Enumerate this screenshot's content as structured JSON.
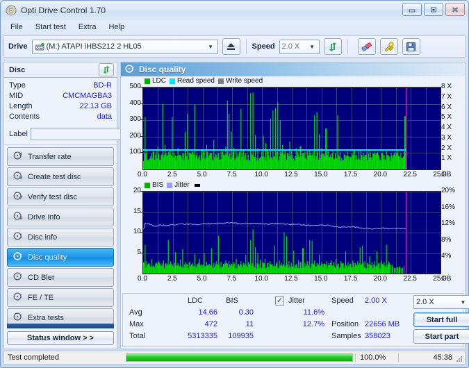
{
  "window": {
    "title": "Opti Drive Control 1.70",
    "app_icon": "disc-icon",
    "minimize_label": "─",
    "maximize_label": "▣",
    "close_label": "✕"
  },
  "menu": {
    "items": [
      "File",
      "Start test",
      "Extra",
      "Help"
    ]
  },
  "toolbar": {
    "drive_label": "Drive",
    "drive_value": "(M:)   ATAPI iHBS212  2 HL05",
    "eject_icon": "eject-icon",
    "speed_label": "Speed",
    "speed_value": "2.0 X",
    "refresh_icon": "refresh-icon",
    "eraser_icon": "eraser-icon",
    "tools_icon": "tools-icon",
    "save_icon": "floppy-save-icon"
  },
  "disc": {
    "header": "Disc",
    "refresh_icon": "refresh-icon",
    "rows": [
      {
        "key": "Type",
        "value": "BD-R"
      },
      {
        "key": "MID",
        "value": "CMCMAGBA3"
      },
      {
        "key": "Length",
        "value": "22.13 GB"
      },
      {
        "key": "Contents",
        "value": "data"
      }
    ],
    "label_key": "Label",
    "label_value": "",
    "label_placeholder": "",
    "disc_icon": "cd-disc-icon"
  },
  "nav": {
    "items": [
      {
        "label": "Transfer rate",
        "icon": "disc-speed-icon",
        "selected": false
      },
      {
        "label": "Create test disc",
        "icon": "disc-burn-icon",
        "selected": false
      },
      {
        "label": "Verify test disc",
        "icon": "disc-check-icon",
        "selected": false
      },
      {
        "label": "Drive info",
        "icon": "disc-info-icon",
        "selected": false
      },
      {
        "label": "Disc info",
        "icon": "disc-info-icon",
        "selected": false
      },
      {
        "label": "Disc quality",
        "icon": "disc-quality-icon",
        "selected": true
      },
      {
        "label": "CD Bler",
        "icon": "disc-bler-icon",
        "selected": false
      },
      {
        "label": "FE / TE",
        "icon": "disc-fete-icon",
        "selected": false
      },
      {
        "label": "Extra tests",
        "icon": "disc-extra-icon",
        "selected": false
      }
    ],
    "status_window_button": "Status window > >"
  },
  "panel": {
    "title": "Disc quality",
    "icon": "disc-quality-icon"
  },
  "stats": {
    "col_ldc": "LDC",
    "col_bis": "BIS",
    "jitter_label": "Jitter",
    "jitter_checked": true,
    "row_avg": "Avg",
    "row_max": "Max",
    "row_total": "Total",
    "avg_ldc": "14.66",
    "avg_bis": "0.30",
    "avg_jitter": "11.6%",
    "max_ldc": "472",
    "max_bis": "11",
    "max_jitter": "12.7%",
    "total_ldc": "5313335",
    "total_bis": "109935",
    "speed_label": "Speed",
    "speed_value": "2.00 X",
    "position_label": "Position",
    "position_value": "22656 MB",
    "samples_label": "Samples",
    "samples_value": "358023",
    "speed_select": "2.0 X",
    "start_full": "Start full",
    "start_part": "Start part"
  },
  "statusbar": {
    "text": "Test completed",
    "progress_percent": 100,
    "percent_label": "100.0%",
    "elapsed": "45:38"
  },
  "colors": {
    "accent_blue": "#1e95e8",
    "value_blue": "#2222cc",
    "plot_bg": "#00007e",
    "ldc_green": "#00e000",
    "read_speed_cyan": "#00e5ff",
    "write_speed_gray": "#808080",
    "bis_green": "#00e000",
    "jitter_periwinkle": "#9a9aff",
    "marker_magenta": "#cc33cc",
    "progress_green": "#22cc22"
  },
  "chart_data": [
    {
      "type": "area",
      "title": "LDC / Read speed / Write speed",
      "xlabel": "GB",
      "ylabel": "LDC",
      "y2label": "X",
      "xlim": [
        0,
        25
      ],
      "xticks": [
        "0.0",
        "2.5",
        "5.0",
        "7.5",
        "10.0",
        "12.5",
        "15.0",
        "17.5",
        "20.0",
        "22.5",
        "25.0"
      ],
      "ylim": [
        0,
        500
      ],
      "yticks": [
        100,
        200,
        300,
        400,
        500
      ],
      "y2lim": [
        0,
        8
      ],
      "y2ticks": [
        "1 X",
        "2 X",
        "3 X",
        "4 X",
        "5 X",
        "6 X",
        "7 X",
        "8 X"
      ],
      "grid": true,
      "legend": [
        {
          "name": "LDC",
          "color": "#00b000"
        },
        {
          "name": "Read speed",
          "color": "#00e5ff"
        },
        {
          "name": "Write speed",
          "color": "#808080"
        }
      ],
      "data_end_gb": 22.1,
      "marker_gb": 22.1,
      "read_speed_constant_x": 2.0,
      "series": [
        {
          "name": "LDC",
          "color": "#00e000",
          "x": [
            0.1,
            0.25,
            0.4,
            0.6,
            0.8,
            1.0,
            1.2,
            1.4,
            1.6,
            1.8,
            2.0,
            2.2,
            2.4,
            2.55,
            2.7,
            2.9,
            3.1,
            3.3,
            3.5,
            3.7,
            3.9,
            4.1,
            4.3,
            4.5,
            4.7,
            4.9,
            5.1,
            5.3,
            5.5,
            5.7,
            5.9,
            6.1,
            6.3,
            6.5,
            6.7,
            6.9,
            7.05,
            7.2,
            7.4,
            7.6,
            7.8,
            8.0,
            8.2,
            8.4,
            8.6,
            8.8,
            9.0,
            9.2,
            9.4,
            9.6,
            9.8,
            9.95,
            10.1,
            10.25,
            10.4,
            10.55,
            10.7,
            10.9,
            11.1,
            11.3,
            11.5,
            11.7,
            11.9,
            12.1,
            12.3,
            12.45,
            12.6,
            12.8,
            13.0,
            13.2,
            13.4,
            13.6,
            13.8,
            14.0,
            14.2,
            14.4,
            14.6,
            14.8,
            15.0,
            15.2,
            15.35,
            15.5,
            15.7,
            15.9,
            16.1,
            16.3,
            16.5,
            16.7,
            16.9,
            17.1,
            17.3,
            17.5,
            17.7,
            17.9,
            18.1,
            18.3,
            18.5,
            18.7,
            18.9,
            19.1,
            19.3,
            19.5,
            19.7,
            19.9,
            20.05,
            20.2,
            20.4,
            20.6,
            20.8,
            21.0,
            21.2,
            21.4,
            21.6,
            21.8,
            22.0,
            22.1
          ],
          "y": [
            318,
            120,
            95,
            80,
            110,
            90,
            140,
            95,
            400,
            150,
            90,
            115,
            320,
            100,
            85,
            130,
            90,
            100,
            230,
            340,
            95,
            110,
            395,
            100,
            90,
            120,
            95,
            150,
            85,
            100,
            180,
            90,
            100,
            110,
            95,
            140,
            420,
            340,
            230,
            130,
            110,
            95,
            370,
            120,
            100,
            90,
            465,
            470,
            210,
            130,
            95,
            110,
            205,
            160,
            120,
            95,
            310,
            360,
            375,
            410,
            300,
            150,
            120,
            100,
            170,
            110,
            95,
            130,
            90,
            140,
            100,
            95,
            110,
            120,
            90,
            330,
            350,
            215,
            130,
            95,
            250,
            110,
            90,
            120,
            100,
            330,
            105,
            95,
            90,
            110,
            95,
            100,
            120,
            90,
            110,
            95,
            100,
            90,
            110,
            95,
            100,
            90,
            105,
            95,
            100,
            90,
            110,
            95,
            100,
            90,
            105,
            95,
            100,
            95,
            325,
            110
          ]
        }
      ]
    },
    {
      "type": "area",
      "title": "BIS / Jitter",
      "xlabel": "GB",
      "ylabel": "BIS",
      "y2label": "%",
      "xlim": [
        0,
        25
      ],
      "xticks": [
        "0.0",
        "2.5",
        "5.0",
        "7.5",
        "10.0",
        "12.5",
        "15.0",
        "17.5",
        "20.0",
        "22.5",
        "25.0"
      ],
      "ylim": [
        0,
        20
      ],
      "yticks": [
        5,
        10,
        15,
        20
      ],
      "y2lim": [
        0,
        20
      ],
      "y2ticks": [
        "4%",
        "8%",
        "12%",
        "16%",
        "20%"
      ],
      "grid": true,
      "legend": [
        {
          "name": "BIS",
          "color": "#00b000"
        },
        {
          "name": "Jitter",
          "color": "#9a9aff"
        }
      ],
      "data_end_gb": 22.1,
      "marker_gb": 22.1,
      "series": [
        {
          "name": "BIS",
          "color": "#00e000",
          "x": [
            0.1,
            0.3,
            0.5,
            0.7,
            0.9,
            1.1,
            1.3,
            1.5,
            1.7,
            1.9,
            2.1,
            2.3,
            2.5,
            2.7,
            2.9,
            3.1,
            3.3,
            3.5,
            3.7,
            3.9,
            4.1,
            4.3,
            4.5,
            4.7,
            4.9,
            5.1,
            5.3,
            5.5,
            5.7,
            5.9,
            6.1,
            6.3,
            6.5,
            6.7,
            6.9,
            7.0,
            7.2,
            7.4,
            7.6,
            7.8,
            8.0,
            8.2,
            8.4,
            8.6,
            8.8,
            9.0,
            9.2,
            9.4,
            9.6,
            9.8,
            10.0,
            10.2,
            10.4,
            10.6,
            10.8,
            11.0,
            11.2,
            11.4,
            11.6,
            11.8,
            12.0,
            12.2,
            12.4,
            12.6,
            12.8,
            13.0,
            13.2,
            13.4,
            13.6,
            13.8,
            14.0,
            14.2,
            14.4,
            14.6,
            14.8,
            15.0,
            15.2,
            15.4,
            15.6,
            15.8,
            16.0,
            16.2,
            16.4,
            16.6,
            16.8,
            17.0,
            17.2,
            17.4,
            17.6,
            17.8,
            18.0,
            18.2,
            18.4,
            18.6,
            18.8,
            19.0,
            19.2,
            19.4,
            19.6,
            19.8,
            20.0,
            20.2,
            20.4,
            20.6,
            20.8,
            21.0,
            21.2,
            21.4,
            21.6,
            21.8,
            22.0,
            22.1
          ],
          "y": [
            7.0,
            3.0,
            2.5,
            3.5,
            2.0,
            2.8,
            3.0,
            2.4,
            3.2,
            2.6,
            8.2,
            3.0,
            2.2,
            5.2,
            2.6,
            3.4,
            6.0,
            2.8,
            2.2,
            3.0,
            2.6,
            4.8,
            2.4,
            3.6,
            2.2,
            5.0,
            2.8,
            2.4,
            6.2,
            2.6,
            3.0,
            9.2,
            2.8,
            2.4,
            3.2,
            2.6,
            3.0,
            2.4,
            2.8,
            3.6,
            2.4,
            3.0,
            2.6,
            4.6,
            2.8,
            8.2,
            10.8,
            6.4,
            5.0,
            3.4,
            2.8,
            3.6,
            2.6,
            3.0,
            2.4,
            6.8,
            2.8,
            3.2,
            2.6,
            10.1,
            9.1,
            3.0,
            2.6,
            5.6,
            2.4,
            3.2,
            2.8,
            6.2,
            2.6,
            3.0,
            8.2,
            8.0,
            3.2,
            2.6,
            4.6,
            2.8,
            2.4,
            3.0,
            2.6,
            3.2,
            2.8,
            3.6,
            2.4,
            3.0,
            2.6,
            5.4,
            2.8,
            2.4,
            3.2,
            2.6,
            3.0,
            6.4,
            6.8,
            3.0,
            2.6,
            4.2,
            2.8,
            3.0,
            5.4,
            2.6,
            3.2,
            2.8,
            7.0,
            3.0
          ]
        },
        {
          "name": "Jitter",
          "color": "#9a9aff",
          "unit": "%",
          "x": [
            0.1,
            0.5,
            1.0,
            1.5,
            2.0,
            2.5,
            3.0,
            3.5,
            4.0,
            4.5,
            5.0,
            5.5,
            6.0,
            6.5,
            7.0,
            7.5,
            8.0,
            8.5,
            9.0,
            9.5,
            10.0,
            10.5,
            11.0,
            11.5,
            12.0,
            12.5,
            13.0,
            13.5,
            14.0,
            14.5,
            15.0,
            15.5,
            16.0,
            16.5,
            17.0,
            17.5,
            18.0,
            18.5,
            19.0,
            19.5,
            20.0,
            20.5,
            21.0,
            21.5,
            22.0,
            22.1
          ],
          "y": [
            12.3,
            12.1,
            11.6,
            11.8,
            11.8,
            11.9,
            12.0,
            12.1,
            12.1,
            12.0,
            12.1,
            12.2,
            12.2,
            12.3,
            12.4,
            12.4,
            12.2,
            12.2,
            12.2,
            12.2,
            12.2,
            12.1,
            12.2,
            12.1,
            12.1,
            12.0,
            12.0,
            11.9,
            11.8,
            11.7,
            11.9,
            11.8,
            11.5,
            11.3,
            11.3,
            11.4,
            11.3,
            11.0,
            11.0,
            10.9,
            11.1,
            11.0,
            11.0,
            11.0,
            11.0,
            11.0
          ]
        }
      ]
    }
  ]
}
